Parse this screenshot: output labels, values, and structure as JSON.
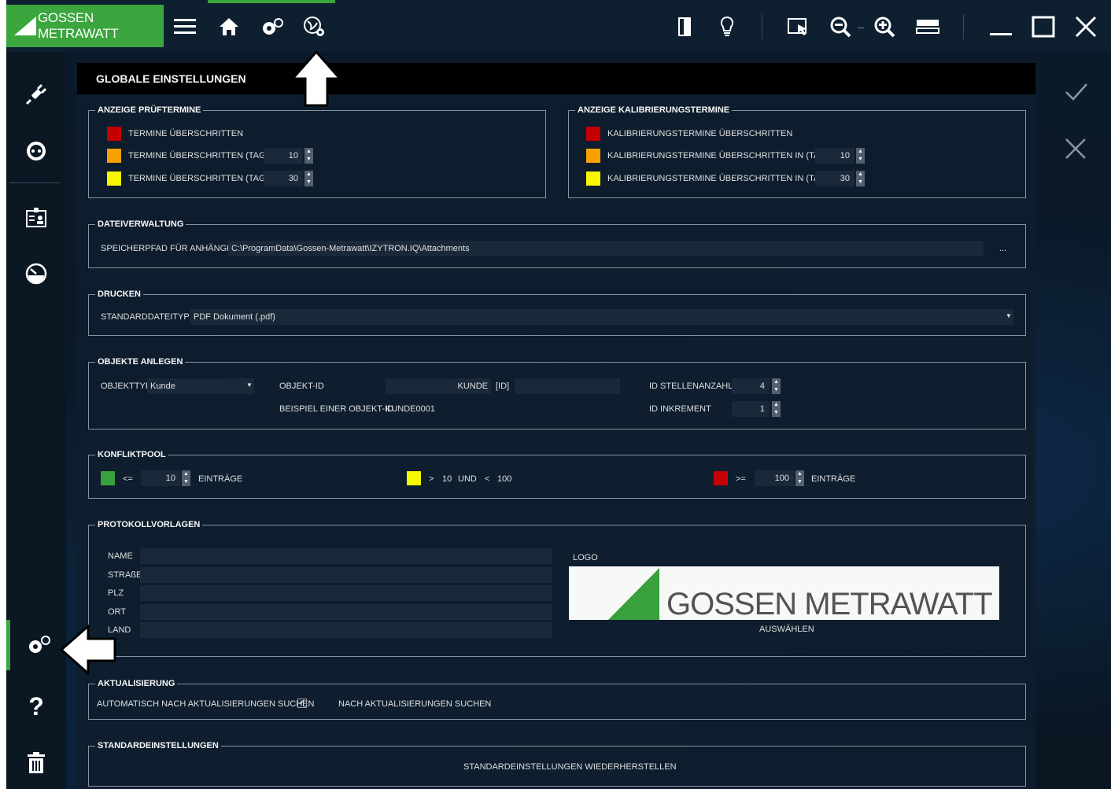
{
  "app": {
    "brand": "GOSSEN METRAWATT"
  },
  "page": {
    "title": "GLOBALE EINSTELLUNGEN"
  },
  "colors": {
    "accent": "#3aa63d",
    "red": "#cc0000",
    "orange": "#ffa500",
    "yellow": "#ffff00",
    "green": "#3aa63d"
  },
  "topbar": {
    "icons": [
      "menu-icon",
      "home-icon",
      "settings-icon",
      "global-settings-icon",
      "door-icon",
      "bulb-icon",
      "select-icon",
      "zoom-out-icon",
      "zoom-in-icon",
      "layout-icon",
      "minimize-icon",
      "maximize-icon",
      "close-icon"
    ]
  },
  "sidebar": {
    "icons": [
      "plug-icon",
      "socket-icon",
      "badge-icon",
      "gauge-icon",
      "settings-icon",
      "help-icon",
      "trash-icon"
    ]
  },
  "anzeige_pruef": {
    "legend": "ANZEIGE PRÜFTERMINE",
    "row1": "TERMINE ÜBERSCHRITTEN",
    "row2": "TERMINE ÜBERSCHRITTEN (TAGE)",
    "row2_value": "10",
    "row3": "TERMINE ÜBERSCHRITTEN (TAGE)",
    "row3_value": "30"
  },
  "anzeige_kalib": {
    "legend": "ANZEIGE KALIBRIERUNGSTERMINE",
    "row1": "KALIBRIERUNGSTERMINE ÜBERSCHRITTEN",
    "row2": "KALIBRIERUNGSTERMINE ÜBERSCHRITTEN IN (TAGE)",
    "row2_value": "10",
    "row3": "KALIBRIERUNGSTERMINE ÜBERSCHRITTEN IN (TAGE)",
    "row3_value": "30"
  },
  "dateiverwaltung": {
    "legend": "DATEIVERWALTUNG",
    "path_label": "SPEICHERPFAD FÜR ANHÄNGE",
    "path_value": "C:\\ProgramData\\Gossen-Metrawatt\\IZYTRON.IQ\\Attachments",
    "browse": "..."
  },
  "drucken": {
    "legend": "DRUCKEN",
    "label": "STANDARDDATEITYP",
    "value": "PDF Dokument (.pdf)"
  },
  "objekte": {
    "legend": "OBJEKTE ANLEGEN",
    "typ_label": "OBJEKTTYP",
    "typ_value": "Kunde",
    "id_label": "OBJEKT-ID",
    "id_prefix": "KUNDE",
    "id_suffix": "[ID]",
    "beispiel_label": "BEISPIEL EINER OBJEKT-ID",
    "beispiel_value": "KUNDE0001",
    "stellen_label": "ID STELLENANZAHL",
    "stellen_value": "4",
    "inkrement_label": "ID INKREMENT",
    "inkrement_value": "1"
  },
  "konfliktpool": {
    "legend": "KONFLIKTPOOL",
    "le": "<=",
    "le_value": "10",
    "eintraege1": "EINTRÄGE",
    "gt": ">",
    "mid_low": "10",
    "und": "UND",
    "lt": "<",
    "mid_high": "100",
    "ge": ">=",
    "ge_value": "100",
    "eintraege2": "EINTRÄGE"
  },
  "protokoll": {
    "legend": "PROTOKOLLVORLAGEN",
    "name": "NAME",
    "strasse": "STRAßE",
    "plz": "PLZ",
    "ort": "ORT",
    "land": "LAND",
    "logo_label": "LOGO",
    "logo_text": "GOSSEN METRAWATT",
    "auswaehlen": "AUSWÄHLEN"
  },
  "aktualisierung": {
    "legend": "AKTUALISIERUNG",
    "auto": "AUTOMATISCH NACH AKTUALISIERUNGEN SUCHEN",
    "check": "✓",
    "suchen": "NACH AKTUALISIERUNGEN SUCHEN"
  },
  "standard": {
    "legend": "STANDARDEINSTELLUNGEN",
    "restore": "STANDARDEINSTELLUNGEN WIEDERHERSTELLEN"
  }
}
